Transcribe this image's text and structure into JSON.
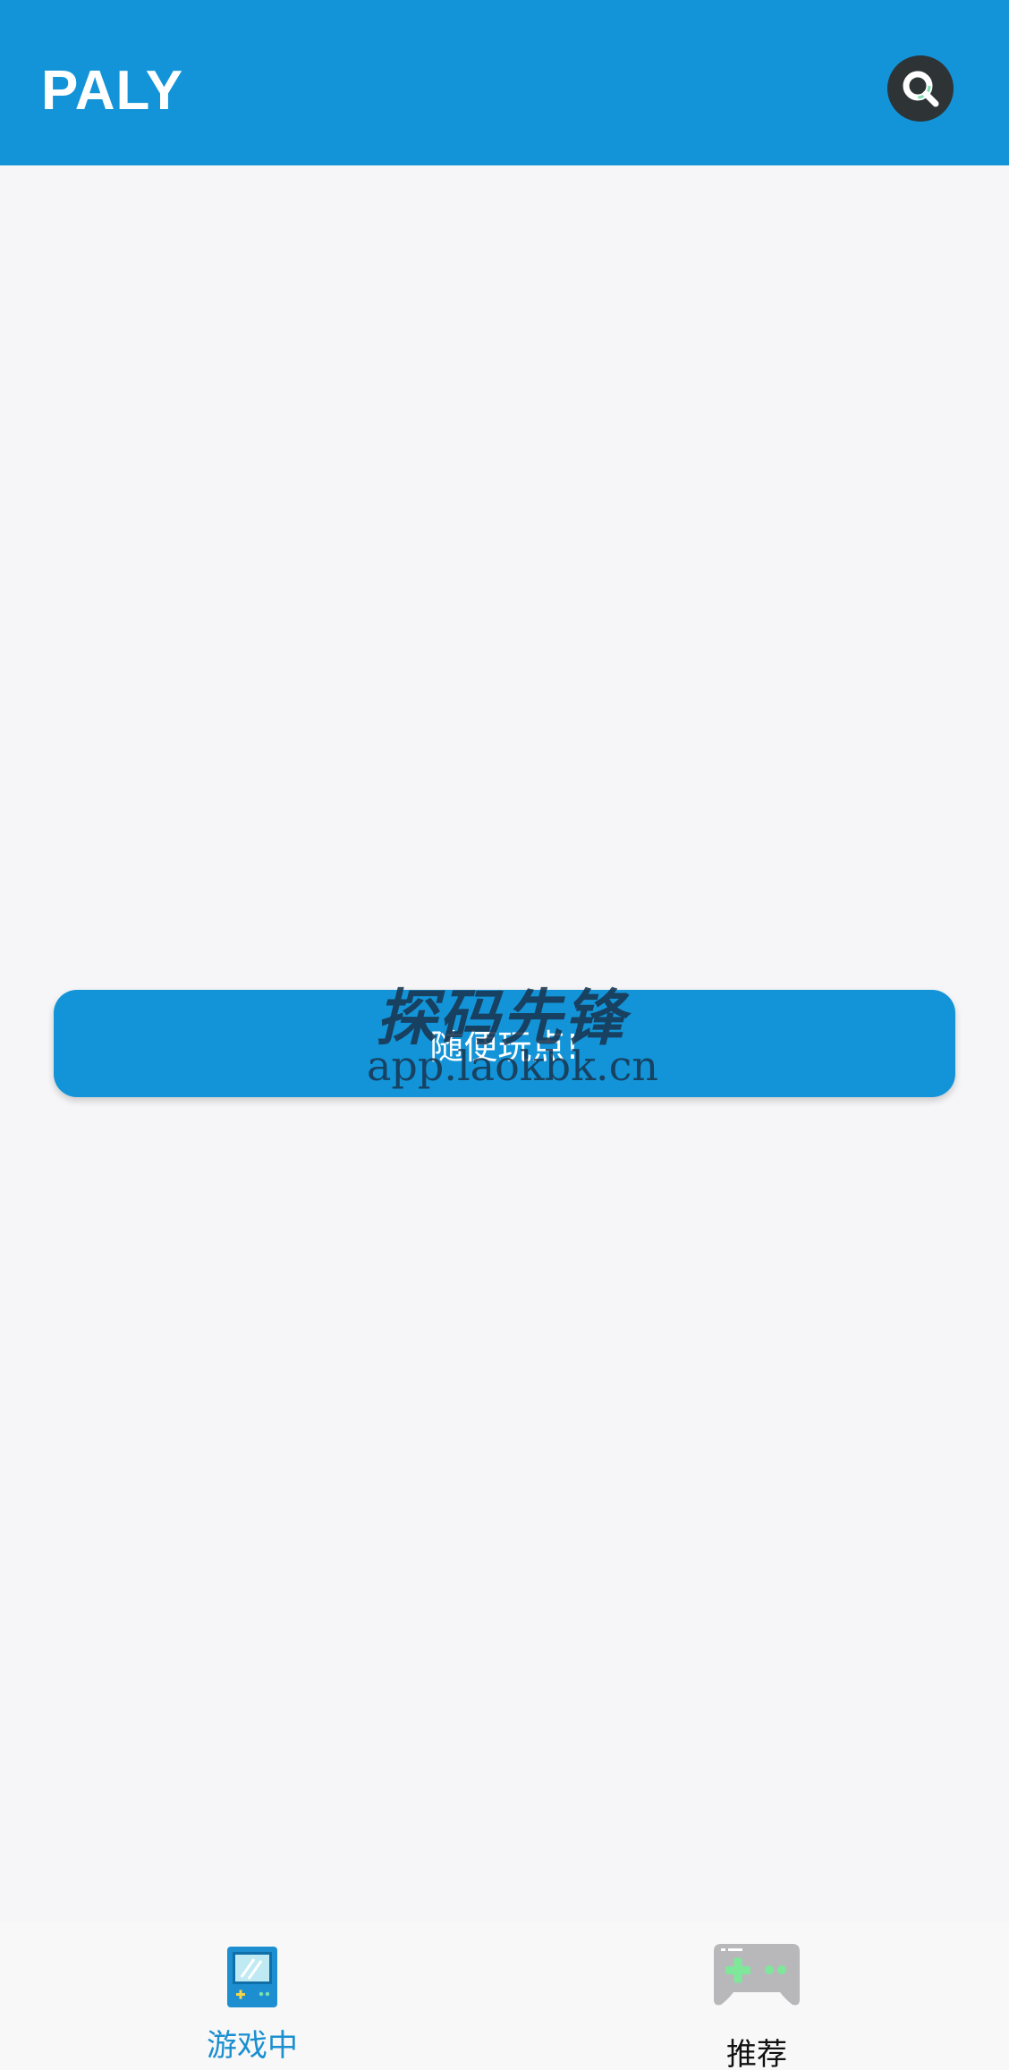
{
  "app_bar": {
    "title": "PALY",
    "search_icon": "search-icon",
    "background_color": "#1394d8"
  },
  "main": {
    "random_play_label": "随便玩点!"
  },
  "watermark": {
    "title": "探码先锋",
    "url": "app.laokbk.cn"
  },
  "bottom_nav": {
    "items": [
      {
        "label": "游戏中",
        "icon": "handheld-console-icon",
        "active": true,
        "color": "#1b8fd0"
      },
      {
        "label": "推荐",
        "icon": "gamepad-icon",
        "active": false,
        "color": "#111111"
      }
    ]
  }
}
